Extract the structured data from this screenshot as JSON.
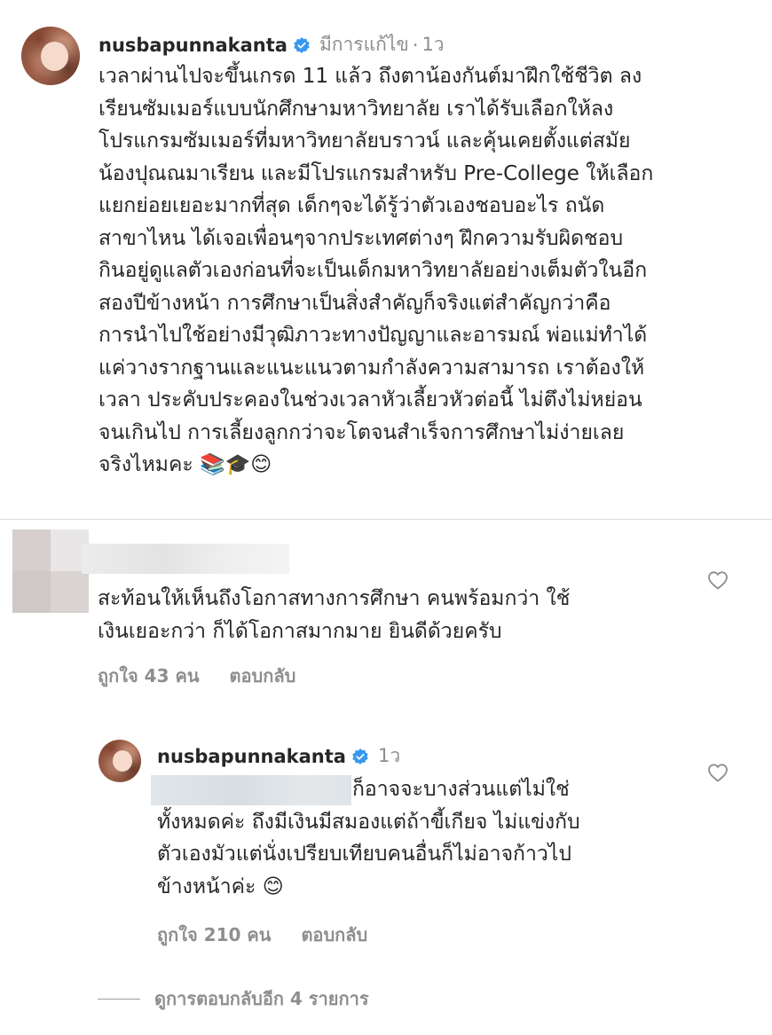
{
  "post": {
    "username": "nusbapunnakanta",
    "edited": "มีการแก้ไข",
    "time": "1ว",
    "caption_lines": [
      "เวลาผ่านไปจะขึ้นเกรด 11 แล้ว ถึงตาน้องกันต์มาฝึกใช้ชีวิต ลง",
      "เรียนซัมเมอร์แบบนักศึกษามหาวิทยาลัย เราได้รับเลือกให้ลง",
      "โปรแกรมซัมเมอร์ที่มหาวิทยาลัยบราวน์ และคุ้นเคยตั้งแต่สมัย",
      "น้องปุณณมาเรียน และมีโปรแกรมสำหรับ Pre-College ให้เลือก",
      "แยกย่อยเยอะมากที่สุด เด็กๆจะได้รู้ว่าตัวเองชอบอะไร ถนัด",
      "สาขาไหน ได้เจอเพื่อนๆจากประเทศต่างๆ ฝึกความรับผิดชอบ",
      "กินอยู่ดูแลตัวเองก่อนที่จะเป็นเด็กมหาวิทยาลัยอย่างเต็มตัวในอีก",
      "สองปีข้างหน้า การศึกษาเป็นสิ่งสำคัญก็จริงแต่สำคัญกว่าคือ",
      "การนำไปใช้อย่างมีวุฒิภาวะทางปัญญาและอารมณ์ พ่อแม่ทำได้",
      "แค่วางรากฐานและแนะแนวตามกำลังความสามารถ เราต้องให้",
      "เวลา ประคับประคองในช่วงเวลาหัวเลี้ยวหัวต่อนี้ ไม่ตึงไม่หย่อน",
      "จนเกินไป การเลี้ยงลูกกว่าจะโตจนสำเร็จการศึกษาไม่ง่ายเลย",
      "จริงไหมคะ 📚🎓😊"
    ]
  },
  "comment": {
    "text_lines": [
      "สะท้อนให้เห็นถึงโอกาสทางการศึกษา คนพร้อมกว่า ใช้",
      "เงินเยอะกว่า ก็ได้โอกาสมากมาย ยินดีด้วยครับ"
    ],
    "likes": "ถูกใจ 43 คน",
    "reply_label": "ตอบกลับ"
  },
  "reply": {
    "username": "nusbapunnakanta",
    "time": "1ว",
    "text_lines": [
      "ก็อาจจะบางส่วนแต่ไม่ใช่",
      "ทั้งหมดค่ะ ถึงมีเงินมีสมองแต่ถ้าขี้เกียจ ไม่แข่งกับ",
      "ตัวเองมัวแต่นั่งเปรียบเทียบคนอื่นก็ไม่อาจก้าวไป",
      "ข้างหน้าค่ะ 😊"
    ],
    "likes": "ถูกใจ 210 คน",
    "reply_label": "ตอบกลับ"
  },
  "view_more_replies": "ดูการตอบกลับอีก 4 รายการ",
  "icons": {
    "verified": "verified-badge-icon",
    "heart": "heart-outline-icon"
  },
  "colors": {
    "text": "#262626",
    "secondary": "#8e8e8e",
    "verified": "#3897f0",
    "divider": "#dbdbdb"
  }
}
